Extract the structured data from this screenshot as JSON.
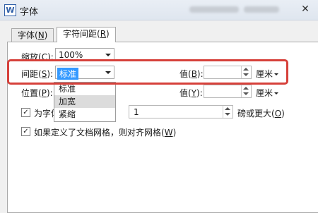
{
  "window": {
    "title": "字体",
    "app_icon": "W",
    "close_glyph": "✕"
  },
  "tabs": [
    {
      "label": "字体(",
      "key": "N",
      "tail": ")",
      "active": false
    },
    {
      "label": "字符间距(",
      "key": "R",
      "tail": ")",
      "active": true
    }
  ],
  "scale": {
    "label": "缩放(",
    "key": "C",
    "tail": "):",
    "value": "100%"
  },
  "spacing": {
    "label": "间距(",
    "key": "S",
    "tail": "):",
    "value": "标准",
    "options": [
      "标准",
      "加宽",
      "紧缩"
    ],
    "hovered_option": "加宽",
    "amount_label": "值(",
    "amount_key": "B",
    "amount_tail": "):",
    "amount_value": "",
    "unit": "厘米"
  },
  "position": {
    "label": "位置(",
    "key": "P",
    "tail": "):",
    "amount_label": "值(",
    "amount_key": "Y",
    "amount_tail": "):",
    "amount_value": "",
    "unit": "厘米"
  },
  "kerning": {
    "checked": true,
    "label": "为字体",
    "value": "1",
    "suffix": "磅或更大(",
    "suffix_key": "O",
    "suffix_tail": ")"
  },
  "grid": {
    "checked": true,
    "label": "如果定义了文档网格，则对齐网格(",
    "key": "W",
    "tail": ")"
  },
  "colors": {
    "highlight": "#d6403a",
    "selection": "#3399ff"
  }
}
